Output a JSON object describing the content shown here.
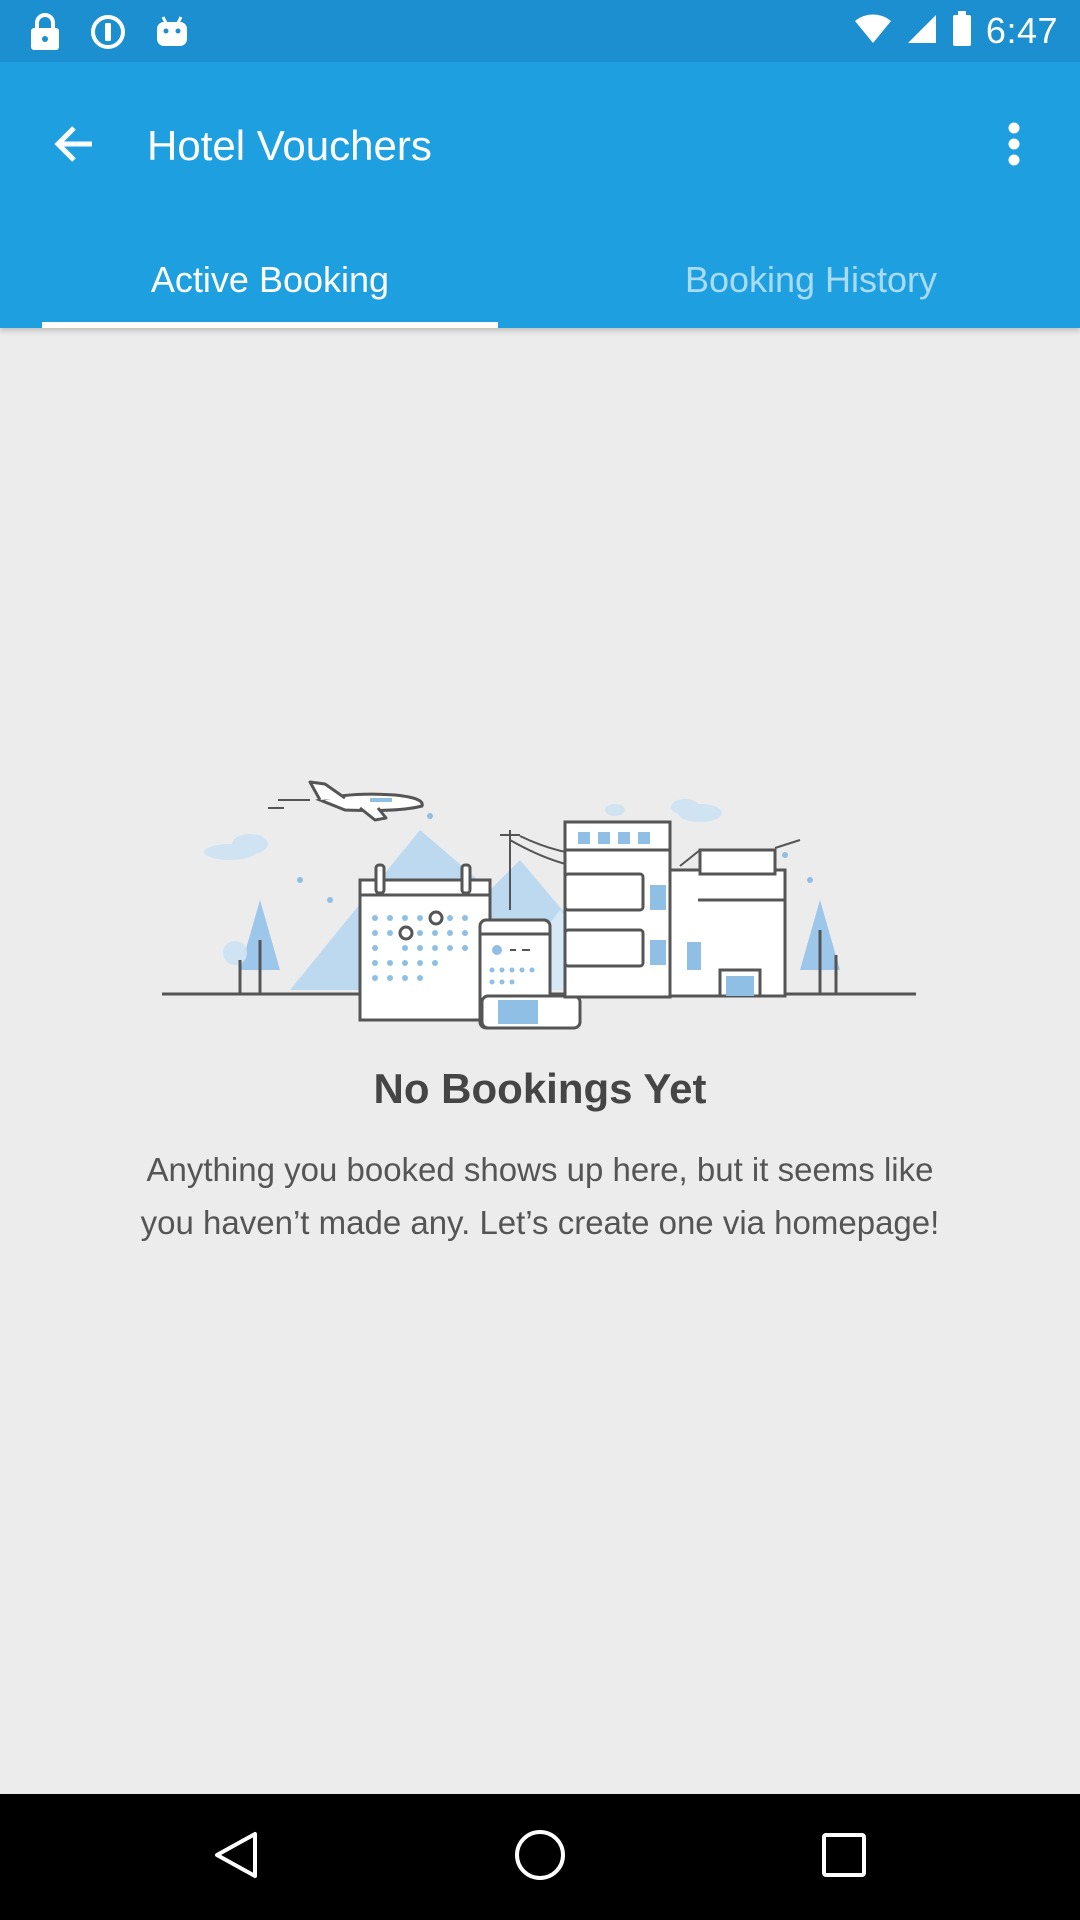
{
  "status_bar": {
    "time": "6:47",
    "icons": [
      "lock-icon",
      "info-icon",
      "android-icon",
      "wifi-icon",
      "signal-icon",
      "battery-icon"
    ]
  },
  "app_bar": {
    "title": "Hotel Vouchers",
    "back_icon": "arrow-back-icon",
    "overflow_icon": "more-vert-icon"
  },
  "tabs": [
    {
      "label": "Active Booking",
      "selected": true
    },
    {
      "label": "Booking History",
      "selected": false
    }
  ],
  "empty_state": {
    "illustration": "hotel-city-illustration",
    "title": "No Bookings Yet",
    "message": "Anything you booked shows up here, but it seems like you haven’t made any. Let’s create one via homepage!"
  },
  "nav_bar": {
    "buttons": [
      "back-triangle-icon",
      "home-circle-icon",
      "recents-square-icon"
    ]
  },
  "colors": {
    "status_bar": "#1b8fd0",
    "app_bar": "#1ea0e0",
    "background": "#ececec",
    "title_text": "#454545",
    "body_text": "#555555"
  }
}
